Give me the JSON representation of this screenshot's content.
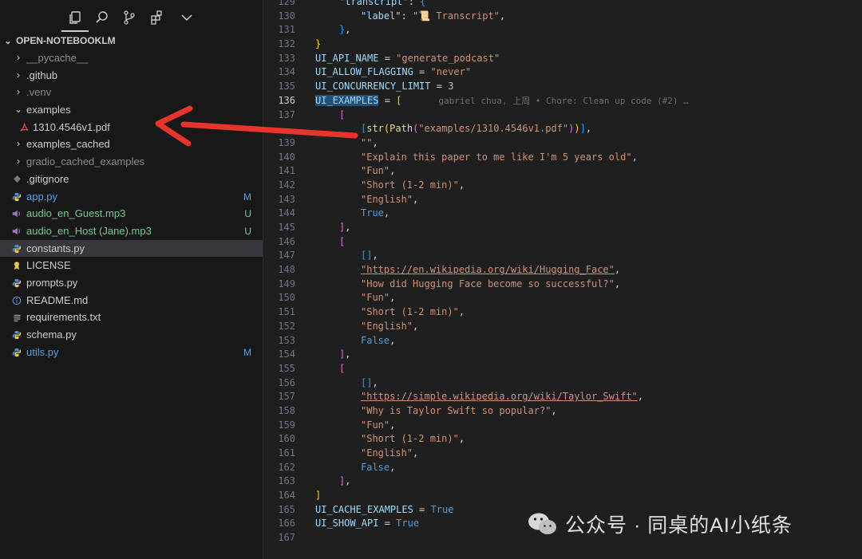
{
  "sidebar": {
    "toolbar_icons": [
      "files-icon",
      "search-icon",
      "source-control-icon",
      "extensions-icon",
      "chevron-down-icon"
    ],
    "section_title": "OPEN-NOTEBOOKLM",
    "items": [
      {
        "label": "__pycache__",
        "type": "folder"
      },
      {
        "label": ".github",
        "type": "folder"
      },
      {
        "label": ".venv",
        "type": "folder"
      },
      {
        "label": "examples",
        "type": "folder-open"
      },
      {
        "label": "1310.4546v1.pdf",
        "type": "pdf"
      },
      {
        "label": "examples_cached",
        "type": "folder"
      },
      {
        "label": "gradio_cached_examples",
        "type": "folder"
      },
      {
        "label": ".gitignore",
        "type": "gitignore"
      },
      {
        "label": "app.py",
        "type": "python",
        "badge": "M"
      },
      {
        "label": "audio_en_Guest.mp3",
        "type": "audio",
        "badge": "U"
      },
      {
        "label": "audio_en_Host (Jane).mp3",
        "type": "audio",
        "badge": "U"
      },
      {
        "label": "constants.py",
        "type": "python"
      },
      {
        "label": "LICENSE",
        "type": "license"
      },
      {
        "label": "prompts.py",
        "type": "python"
      },
      {
        "label": "README.md",
        "type": "info"
      },
      {
        "label": "requirements.txt",
        "type": "text"
      },
      {
        "label": "schema.py",
        "type": "python"
      },
      {
        "label": "utils.py",
        "type": "python",
        "badge": "M"
      }
    ]
  },
  "editor": {
    "line_numbers": [
      "129",
      "130",
      "131",
      "132",
      "133",
      "134",
      "135",
      "136",
      "137",
      "",
      "139",
      "140",
      "141",
      "142",
      "143",
      "144",
      "145",
      "146",
      "147",
      "148",
      "149",
      "150",
      "151",
      "152",
      "153",
      "154",
      "155",
      "156",
      "157",
      "158",
      "159",
      "160",
      "161",
      "162",
      "163",
      "164",
      "165",
      "166",
      "167"
    ],
    "current_line": "136",
    "blame": "gabriel chua, 上周 • Chore: Clean up code (#2) …",
    "tokens": {
      "transcript_key": "\"transcript\"",
      "label_key": "\"label\"",
      "transcript_label": "\"📜 Transcript\"",
      "api_name_var": "UI_API_NAME",
      "api_name_val": "\"generate_podcast\"",
      "flagging_var": "UI_ALLOW_FLAGGING",
      "flagging_val": "\"never\"",
      "concurrency_var": "UI_CONCURRENCY_LIMIT",
      "concurrency_val": "3",
      "examples_var": "UI_EXAMPLES",
      "str_fn": "str",
      "path_fn": "Path",
      "pdf_path": "\"examples/1310.4546v1.pdf\"",
      "empty_str": "\"\"",
      "q1": "\"Explain this paper to me like I'm 5 years old\"",
      "fun": "\"Fun\"",
      "short": "\"Short (1-2 min)\"",
      "english": "\"English\"",
      "true_kw": "True",
      "false_kw": "False",
      "url1": "\"https://en.wikipedia.org/wiki/Hugging_Face\"",
      "q2": "\"How did Hugging Face become so successful?\"",
      "url2": "\"https://simple.wikipedia.org/wiki/Taylor_Swift\"",
      "q3": "\"Why is Taylor Swift so popular?\"",
      "cache_var": "UI_CACHE_EXAMPLES",
      "show_api_var": "UI_SHOW_API"
    }
  },
  "watermark": {
    "text": "公众号 · 同桌的AI小纸条",
    "icon": "wechat-icon"
  },
  "colors": {
    "arrow": "#e8352b",
    "modified": "#4fa3e6",
    "untracked": "#73c991"
  }
}
